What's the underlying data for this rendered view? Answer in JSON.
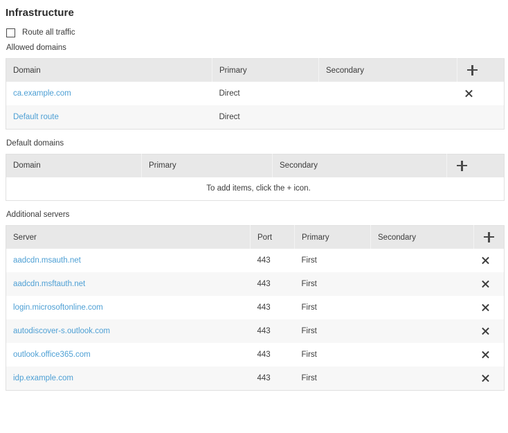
{
  "page": {
    "title": "Infrastructure"
  },
  "route_all_traffic": {
    "label": "Route all traffic",
    "checked": false
  },
  "allowed_domains": {
    "section_label": "Allowed domains",
    "columns": [
      "Domain",
      "Primary",
      "Secondary"
    ],
    "add_icon": "plus-icon",
    "rows": [
      {
        "domain": "ca.example.com",
        "primary": "Direct",
        "secondary": "",
        "remove_icon": "close-icon",
        "has_remove": true
      },
      {
        "domain": "Default route",
        "primary": "Direct",
        "secondary": "",
        "remove_icon": "close-icon",
        "has_remove": false
      }
    ]
  },
  "default_domains": {
    "section_label": "Default domains",
    "columns": [
      "Domain",
      "Primary",
      "Secondary"
    ],
    "add_icon": "plus-icon",
    "empty_message": "To add items, click the + icon.",
    "rows": []
  },
  "additional_servers": {
    "section_label": "Additional servers",
    "columns": [
      "Server",
      "Port",
      "Primary",
      "Secondary"
    ],
    "add_icon": "plus-icon",
    "rows": [
      {
        "server": "aadcdn.msauth.net",
        "port": "443",
        "primary": "First",
        "secondary": "",
        "remove_icon": "close-icon"
      },
      {
        "server": "aadcdn.msftauth.net",
        "port": "443",
        "primary": "First",
        "secondary": "",
        "remove_icon": "close-icon"
      },
      {
        "server": "login.microsoftonline.com",
        "port": "443",
        "primary": "First",
        "secondary": "",
        "remove_icon": "close-icon"
      },
      {
        "server": "autodiscover-s.outlook.com",
        "port": "443",
        "primary": "First",
        "secondary": "",
        "remove_icon": "close-icon"
      },
      {
        "server": "outlook.office365.com",
        "port": "443",
        "primary": "First",
        "secondary": "",
        "remove_icon": "close-icon"
      },
      {
        "server": "idp.example.com",
        "port": "443",
        "primary": "First",
        "secondary": "",
        "remove_icon": "close-icon"
      }
    ]
  },
  "colors": {
    "link": "#4d9fd4",
    "header_bg": "#e8e8e8",
    "row_alt_bg": "#f7f7f7",
    "border": "#e0e0e0",
    "text": "#3b3b3b"
  }
}
